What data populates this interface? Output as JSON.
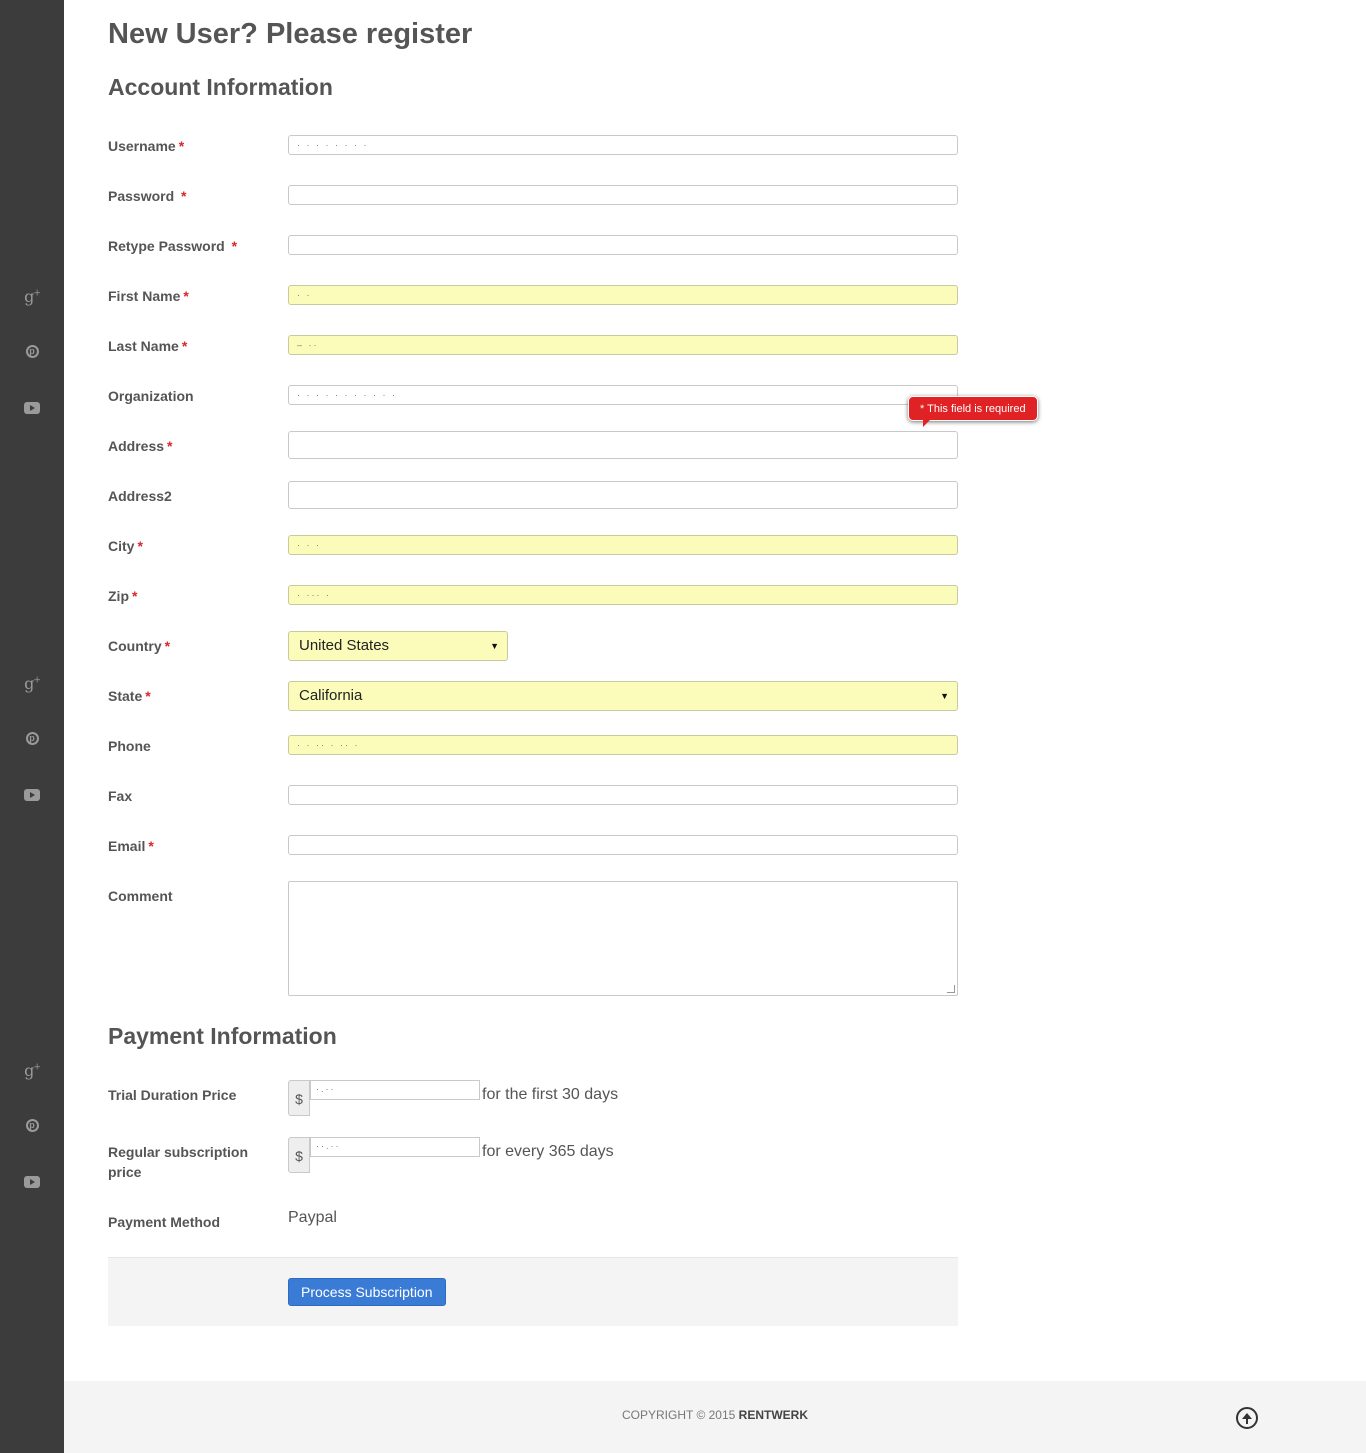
{
  "page": {
    "title": "New User? Please register",
    "account_heading": "Account Information",
    "payment_heading": "Payment Information"
  },
  "required_mark": "*",
  "sidebar": {
    "icons": [
      "google-plus-icon",
      "pinterest-icon",
      "youtube-icon"
    ]
  },
  "fields": {
    "username": {
      "label": "Username",
      "value": "· · · · · · · ·"
    },
    "password": {
      "label": "Password",
      "value": ""
    },
    "retype_password": {
      "label": "Retype Password",
      "value": ""
    },
    "first_name": {
      "label": "First Name",
      "value": "· ·"
    },
    "last_name": {
      "label": "Last Name",
      "value": "– ··"
    },
    "organization": {
      "label": "Organization",
      "value": "· · · · · · · · · · ·"
    },
    "address": {
      "label": "Address",
      "value": ""
    },
    "address2": {
      "label": "Address2",
      "value": ""
    },
    "city": {
      "label": "City",
      "value": "· · ·"
    },
    "zip": {
      "label": "Zip",
      "value": "· ··· ·"
    },
    "country": {
      "label": "Country",
      "value": "United States"
    },
    "state": {
      "label": "State",
      "value": "California"
    },
    "phone": {
      "label": "Phone",
      "value": "· · ·· · ·· ·"
    },
    "fax": {
      "label": "Fax",
      "value": ""
    },
    "email": {
      "label": "Email",
      "value": ""
    },
    "comment": {
      "label": "Comment",
      "value": ""
    }
  },
  "validation": {
    "address_error": "* This field is required"
  },
  "payment": {
    "currency_symbol": "$",
    "trial": {
      "label": "Trial Duration Price",
      "value": "·.··",
      "period": "for the first 30 days"
    },
    "regular": {
      "label": "Regular subscription price",
      "value": "··.··",
      "period": "for every 365 days"
    },
    "method": {
      "label": "Payment Method",
      "value": "Paypal"
    },
    "submit_label": "Process Subscription"
  },
  "footer": {
    "copyright": "COPYRIGHT © 2015",
    "brand": "RENTWERK"
  },
  "colors": {
    "sidebar": "#3c3c3c",
    "required": "#d9262b",
    "autofill": "#fbfcb9",
    "button": "#3a7bd5",
    "tooltip": "#e12225"
  }
}
